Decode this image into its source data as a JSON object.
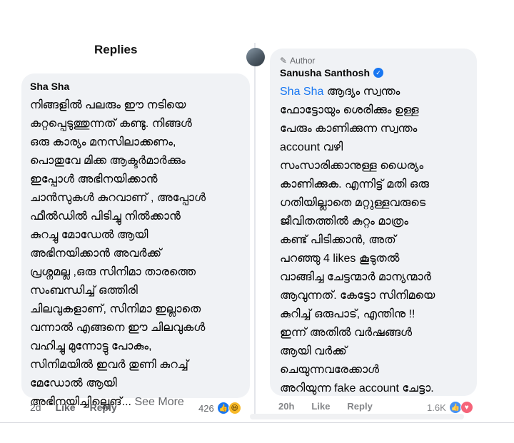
{
  "replies_header": "Replies",
  "left_comment": {
    "author": "Sha Sha",
    "lines": [
      "നിങ്ങളിൽ പലരും ഈ നടിയെ",
      "കുറ്റപ്പെടുത്തുന്നത് കണ്ടു. നിങ്ങൾ",
      "ഒരു കാര്യം മനസിലാക്കണം,",
      "പൊതുവേ മിക്ക ആക്ടർമാർക്കും",
      "ഇപ്പോൾ അഭിനയിക്കാൻ",
      "ചാൻസുകൾ കുറവാണ് , അപ്പോൾ",
      "ഫീൽഡിൽ പിടിച്ചു നിൽക്കാൻ",
      "കുറച്ചു മോഡേൽ ആയി",
      "അഭിനയിക്കാൻ അവർക്ക്",
      "പ്രശ്നമല്ല ,ഒരു സിനിമാ താരത്തെ",
      "സംബന്ധിച്ച് ഒത്തിരി",
      "ചിലവുകളാണ്, സിനിമാ ഇല്ലാതെ",
      "വന്നാൽ എങ്ങനെ ഈ ചിലവുകൾ",
      "വഹിച്ചു മുന്നോട്ടു പോകും,",
      "സിനിമയിൽ ഇവർ തുണി കുറച്ച്",
      "മേഡോൽ ആയി"
    ],
    "last_line": "അഭിനയിച്ചില്ലെങ്...",
    "see_more": "See More",
    "time": "2d",
    "like_label": "Like",
    "reply_label": "Reply",
    "reaction_count": "426"
  },
  "right_comment": {
    "badge": "Author",
    "author": "Sanusha Santhosh",
    "mention": "Sha Sha",
    "first_line_rest": "ആദ്യം സ്വന്തം",
    "lines": [
      "ഫോട്ടോയും ശെരിക്കും ഉള്ള",
      "പേരും കാണിക്കുന്ന സ്വന്തം",
      "account വഴി",
      "സംസാരിക്കാനുള്ള ധൈര്യം",
      "കാണിക്കുക. എന്നിട്ട് മതി ഒരു",
      "ഗതിയില്ലാതെ മറ്റുള്ളവരുടെ",
      "ജീവിതത്തിൽ കുറ്റം മാത്രം",
      "കണ്ട് പിടിക്കാൻ, അത്",
      "പറഞ്ഞു 4 likes കൂടുതൽ",
      "വാങ്ങിച്ച ചേട്ടന്മാർ മാന്യന്മാർ",
      "ആവുന്നത്.  കേട്ടോ സിനിമയെ",
      "കുറിച്ച് ഒരുപാട്, എന്തിനു !!",
      "ഇന്ന് അതിൽ വർഷങ്ങൾ",
      "ആയി വർക്ക്",
      "ചെയുന്നവരേക്കാൾ",
      "അറിയുന്ന fake account ചേട്ടാ."
    ],
    "time": "20h",
    "like_label": "Like",
    "reply_label": "Reply",
    "reaction_count": "1.6K"
  }
}
